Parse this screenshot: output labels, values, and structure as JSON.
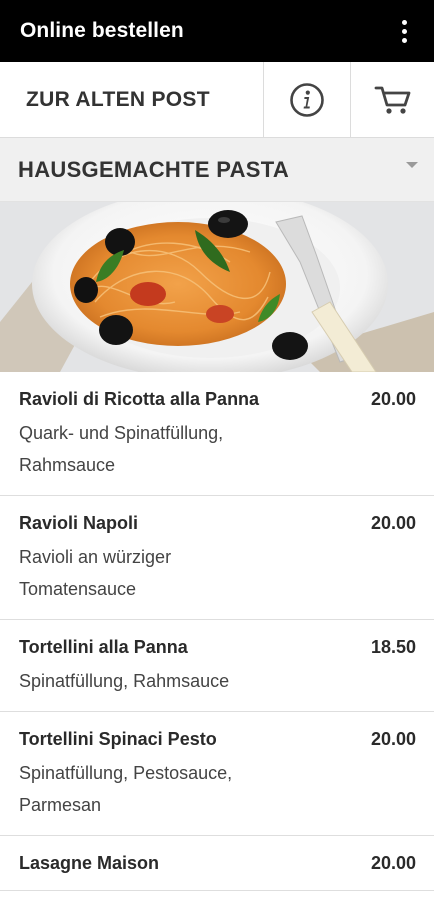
{
  "appbar": {
    "title": "Online bestellen"
  },
  "toolbar": {
    "restaurant_name": "ZUR ALTEN POST"
  },
  "category": {
    "title": "HAUSGEMACHTE PASTA"
  },
  "menu": {
    "items": [
      {
        "name": "Ravioli di Ricotta alla Panna",
        "price": "20.00",
        "desc_lines": [
          "Quark- und Spinatfüllung,",
          "Rahmsauce"
        ]
      },
      {
        "name": "Ravioli Napoli",
        "price": "20.00",
        "desc_lines": [
          "Ravioli an würziger",
          "Tomatensauce"
        ]
      },
      {
        "name": "Tortellini alla Panna",
        "price": "18.50",
        "desc_lines": [
          "Spinatfüllung, Rahmsauce"
        ]
      },
      {
        "name": "Tortellini Spinaci Pesto",
        "price": "20.00",
        "desc_lines": [
          "Spinatfüllung, Pestosauce,",
          "Parmesan"
        ]
      },
      {
        "name": "Lasagne Maison",
        "price": "20.00",
        "desc_lines": []
      }
    ]
  },
  "colors": {
    "appbar": "#000000",
    "category_bg": "#f0f0f0",
    "divider": "#dedede"
  },
  "icons": {
    "menu": "more-vert-icon",
    "info": "info-icon",
    "cart": "cart-icon"
  }
}
